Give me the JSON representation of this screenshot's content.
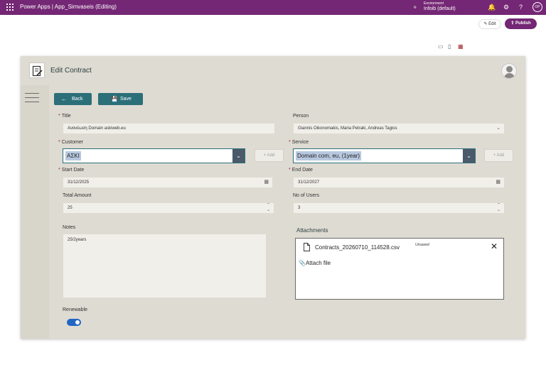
{
  "topbar": {
    "app_title": "Power Apps  |  App_Simvaseis (Editing)",
    "environment_label": "Environment",
    "environment_name": "Infoib (default)",
    "user_initials": "OP"
  },
  "studio": {
    "edit_label": "Edit",
    "publish_label": "Publish",
    "edit_icon": "pencil-icon",
    "publish_icon": "publish-icon"
  },
  "header": {
    "title": "Edit Contract",
    "logo_icon": "contract-edit-icon",
    "avatar_icon": "user-avatar-icon"
  },
  "toolbar": {
    "back_label": "Back",
    "save_label": "Save",
    "back_icon": "arrow-left-icon",
    "save_icon": "save-icon"
  },
  "form": {
    "title": {
      "label": "Title",
      "value": "Ανανέωση Domain askiweb.eu",
      "required": true
    },
    "person": {
      "label": "Person",
      "value": "Giannis Oikonomakis, Maria Petraki, Andreas Tagios"
    },
    "customer": {
      "label": "Customer",
      "value": "ΑΣΚΙ",
      "required": true,
      "add_label": "Add"
    },
    "service": {
      "label": "Service",
      "value": "Domain com, eu, (1year)",
      "required": true,
      "add_label": "Add"
    },
    "start_date": {
      "label": "Start Date",
      "value": "31/12/2025",
      "required": true
    },
    "end_date": {
      "label": "End Date",
      "value": "31/12/2027",
      "required": true
    },
    "total_amount": {
      "label": "Total Amount",
      "value": "25"
    },
    "no_of_users": {
      "label": "No of Users",
      "value": "3"
    },
    "notes": {
      "label": "Notes",
      "value": "25/2years"
    },
    "attachments": {
      "label": "Attachments",
      "file_name": "Contracts_20260710_114528.csv",
      "file_status": "Unsaved",
      "attach_label": "Attach file"
    },
    "renewable": {
      "label": "Renewable",
      "value": true
    }
  },
  "colors": {
    "suite_bar": "#742774",
    "button": "#2b6f79",
    "canvas": "#d8d5cb",
    "toggle_on": "#2266c4"
  }
}
